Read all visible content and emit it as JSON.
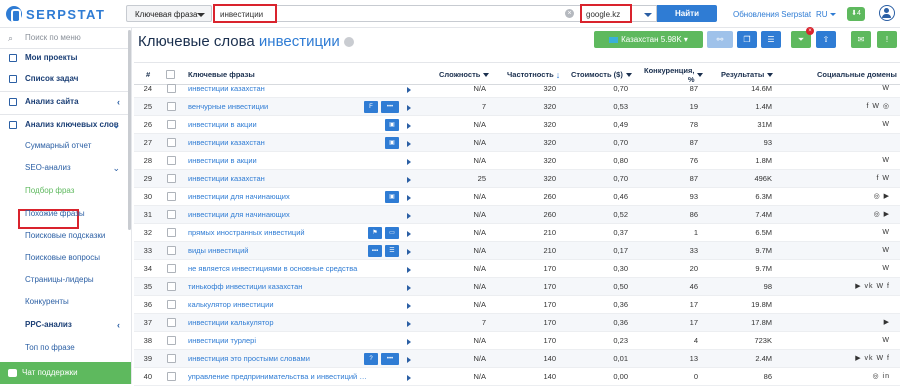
{
  "brand": {
    "name": "SERPSTAT"
  },
  "search": {
    "type_label": "Ключевая фраза",
    "query": "инвестиции",
    "engine": "google.kz",
    "find_label": "Найти"
  },
  "header": {
    "updates_label": "Обновления Serpstat",
    "lang": "RU",
    "notifications": "4"
  },
  "sidebar": {
    "search_placeholder": "Поиск по меню",
    "items": [
      {
        "label": "Мои проекты"
      },
      {
        "label": "Список задач"
      },
      {
        "label": "Анализ сайта"
      },
      {
        "label": "Анализ ключевых слов"
      },
      {
        "label": "Суммарный отчет"
      },
      {
        "label": "SEO-анализ"
      },
      {
        "label": "Подбор фраз"
      },
      {
        "label": "Похожие фразы"
      },
      {
        "label": "Поисковые подсказки"
      },
      {
        "label": "Поисковые вопросы"
      },
      {
        "label": "Страницы-лидеры"
      },
      {
        "label": "Конкуренты"
      },
      {
        "label": "PPC-анализ"
      },
      {
        "label": "Топ по фразе"
      }
    ],
    "support_label": "Чат поддержки"
  },
  "page": {
    "title_prefix": "Ключевые слова",
    "title_query": "инвестиции",
    "region_label": "Казахстан 5.98K"
  },
  "table": {
    "headers": {
      "num": "#",
      "keyword": "Ключевые фразы",
      "difficulty": "Сложность",
      "frequency": "Частотность",
      "cost": "Стоимость ($)",
      "competition": "Конкуренция, %",
      "results": "Результаты",
      "social": "Социальные домены"
    },
    "rows": [
      {
        "n": "24",
        "kw": "инвестиции казахстан",
        "d": "N/A",
        "f": "320",
        "c": "0,70",
        "k": "87",
        "r": "14.6M",
        "s": "W"
      },
      {
        "n": "25",
        "kw": "венчурные инвестиции",
        "d": "7",
        "f": "320",
        "c": "0,53",
        "k": "19",
        "r": "1.4M",
        "s": "f W ◎"
      },
      {
        "n": "26",
        "kw": "инвестиции в акции",
        "d": "N/A",
        "f": "320",
        "c": "0,49",
        "k": "78",
        "r": "31M",
        "s": "W"
      },
      {
        "n": "27",
        "kw": "инвестиции казахстан",
        "d": "N/A",
        "f": "320",
        "c": "0,70",
        "k": "87",
        "r": "93",
        "s": ""
      },
      {
        "n": "28",
        "kw": "инвестиции в акции",
        "d": "N/A",
        "f": "320",
        "c": "0,80",
        "k": "76",
        "r": "1.8M",
        "s": "W"
      },
      {
        "n": "29",
        "kw": "инвестиции казахстан",
        "d": "25",
        "f": "320",
        "c": "0,70",
        "k": "87",
        "r": "496K",
        "s": "f W"
      },
      {
        "n": "30",
        "kw": "инвестиции для начинающих",
        "d": "N/A",
        "f": "260",
        "c": "0,46",
        "k": "93",
        "r": "6.3M",
        "s": "◎ ▶"
      },
      {
        "n": "31",
        "kw": "инвестиции для начинающих",
        "d": "N/A",
        "f": "260",
        "c": "0,52",
        "k": "86",
        "r": "7.4M",
        "s": "◎ ▶"
      },
      {
        "n": "32",
        "kw": "прямых иностранных инвестиций",
        "d": "N/A",
        "f": "210",
        "c": "0,37",
        "k": "1",
        "r": "6.5M",
        "s": "W"
      },
      {
        "n": "33",
        "kw": "виды инвестиций",
        "d": "N/A",
        "f": "210",
        "c": "0,17",
        "k": "33",
        "r": "9.7M",
        "s": "W"
      },
      {
        "n": "34",
        "kw": "не является инвестициями в основные средства",
        "d": "N/A",
        "f": "170",
        "c": "0,30",
        "k": "20",
        "r": "9.7M",
        "s": "W"
      },
      {
        "n": "35",
        "kw": "тинькофф инвестиции казахстан",
        "d": "N/A",
        "f": "170",
        "c": "0,50",
        "k": "46",
        "r": "98",
        "s": "▶ vk W f"
      },
      {
        "n": "36",
        "kw": "калькулятор инвестиции",
        "d": "N/A",
        "f": "170",
        "c": "0,36",
        "k": "17",
        "r": "19.8M",
        "s": ""
      },
      {
        "n": "37",
        "kw": "инвестиции калькулятор",
        "d": "7",
        "f": "170",
        "c": "0,36",
        "k": "17",
        "r": "17.8M",
        "s": "▶"
      },
      {
        "n": "38",
        "kw": "инвестиции турлері",
        "d": "N/A",
        "f": "170",
        "c": "0,23",
        "k": "4",
        "r": "723K",
        "s": "W"
      },
      {
        "n": "39",
        "kw": "инвестиция это простыми словами",
        "d": "N/A",
        "f": "140",
        "c": "0,01",
        "k": "13",
        "r": "2.4M",
        "s": "▶ vk W f"
      },
      {
        "n": "40",
        "kw": "управление предпринимательства и инвестиций города алм...",
        "d": "N/A",
        "f": "140",
        "c": "0,00",
        "k": "0",
        "r": "86",
        "s": "◎ in"
      }
    ]
  },
  "colors": {
    "accent": "#2f7cd4",
    "green": "#5eb95e",
    "red": "#d9232d"
  }
}
